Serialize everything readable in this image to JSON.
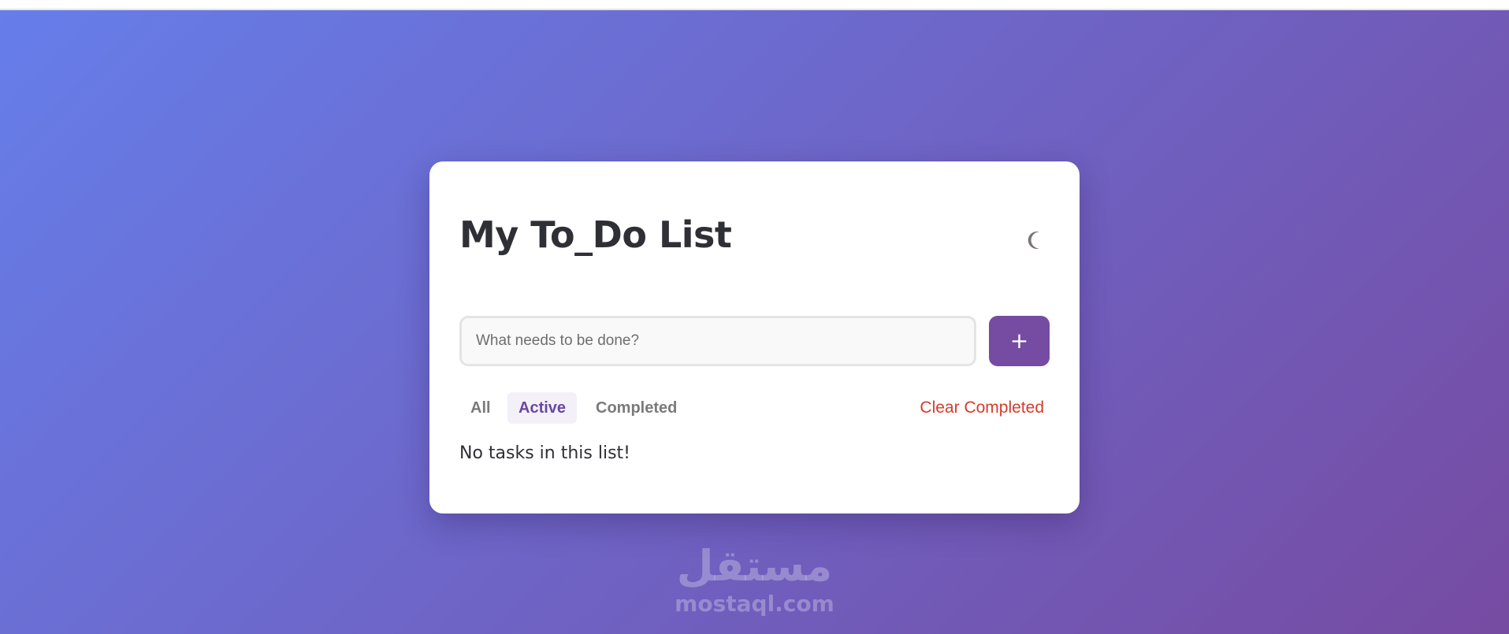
{
  "app": {
    "title": "My To_Do List",
    "theme_toggle_icon": "moon-icon"
  },
  "input": {
    "value": "",
    "placeholder": "What needs to be done?"
  },
  "add_button": {
    "label": "+",
    "color": "#764ba2"
  },
  "filters": [
    {
      "label": "All",
      "active": false
    },
    {
      "label": "Active",
      "active": true
    },
    {
      "label": "Completed",
      "active": false
    }
  ],
  "clear_completed_label": "Clear Completed",
  "empty_message": "No tasks in this list!",
  "watermark": {
    "logo_text": "مستقل",
    "url": "mostaql.com"
  },
  "colors": {
    "background_start": "#667eea",
    "background_end": "#764ba2",
    "accent": "#764ba2",
    "danger": "#d33c2e"
  }
}
